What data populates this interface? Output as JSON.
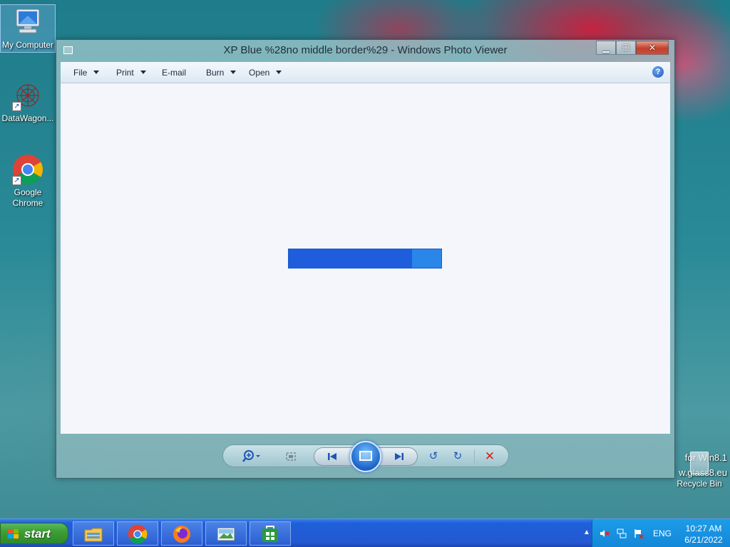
{
  "desktop": {
    "icons": [
      {
        "label": "My Computer",
        "icon": "computer-icon"
      },
      {
        "label": "DataWagon...",
        "icon": "datawagon-icon"
      },
      {
        "label": "Google Chrome",
        "icon": "chrome-icon"
      }
    ],
    "watermark": [
      "for Win8.1",
      "w.glass8.eu"
    ],
    "recycle_bin": {
      "label": "Recycle Bin",
      "icon": "recycle-bin-icon"
    }
  },
  "window": {
    "title": "XP Blue %28no middle border%29 - Windows Photo Viewer",
    "controls": {
      "minimize": "minimize-icon",
      "maximize": "maximize-icon",
      "close": "close-icon"
    },
    "menu": [
      {
        "label": "File",
        "has_dropdown": true
      },
      {
        "label": "Print",
        "has_dropdown": true
      },
      {
        "label": "E-mail",
        "has_dropdown": false
      },
      {
        "label": "Burn",
        "has_dropdown": true
      },
      {
        "label": "Open",
        "has_dropdown": true
      }
    ],
    "help_glyph": "?",
    "loading_progress": 0.81,
    "toolbar": [
      {
        "icon": "zoom-icon"
      },
      {
        "icon": "actual-size-icon"
      },
      {
        "icon": "previous-icon"
      },
      {
        "icon": "slideshow-icon"
      },
      {
        "icon": "next-icon"
      },
      {
        "icon": "rotate-left-icon"
      },
      {
        "icon": "rotate-right-icon"
      },
      {
        "icon": "delete-icon"
      }
    ]
  },
  "taskbar": {
    "start_label": "start",
    "apps": [
      {
        "name": "File Explorer",
        "icon": "folder-icon"
      },
      {
        "name": "Google Chrome",
        "icon": "chrome-icon"
      },
      {
        "name": "Firefox",
        "icon": "firefox-icon"
      },
      {
        "name": "Windows Photo Viewer",
        "icon": "photo-viewer-icon"
      },
      {
        "name": "Store",
        "icon": "store-icon"
      }
    ],
    "tray": {
      "language": "ENG",
      "time": "10:27 AM",
      "date": "6/21/2022"
    }
  },
  "colors": {
    "taskbar": "#245ad4",
    "start_button": "#3d9e37",
    "progress_track": "#2a86e8",
    "progress_fill": "#1e5ddc",
    "close_button": "#c2402c"
  }
}
